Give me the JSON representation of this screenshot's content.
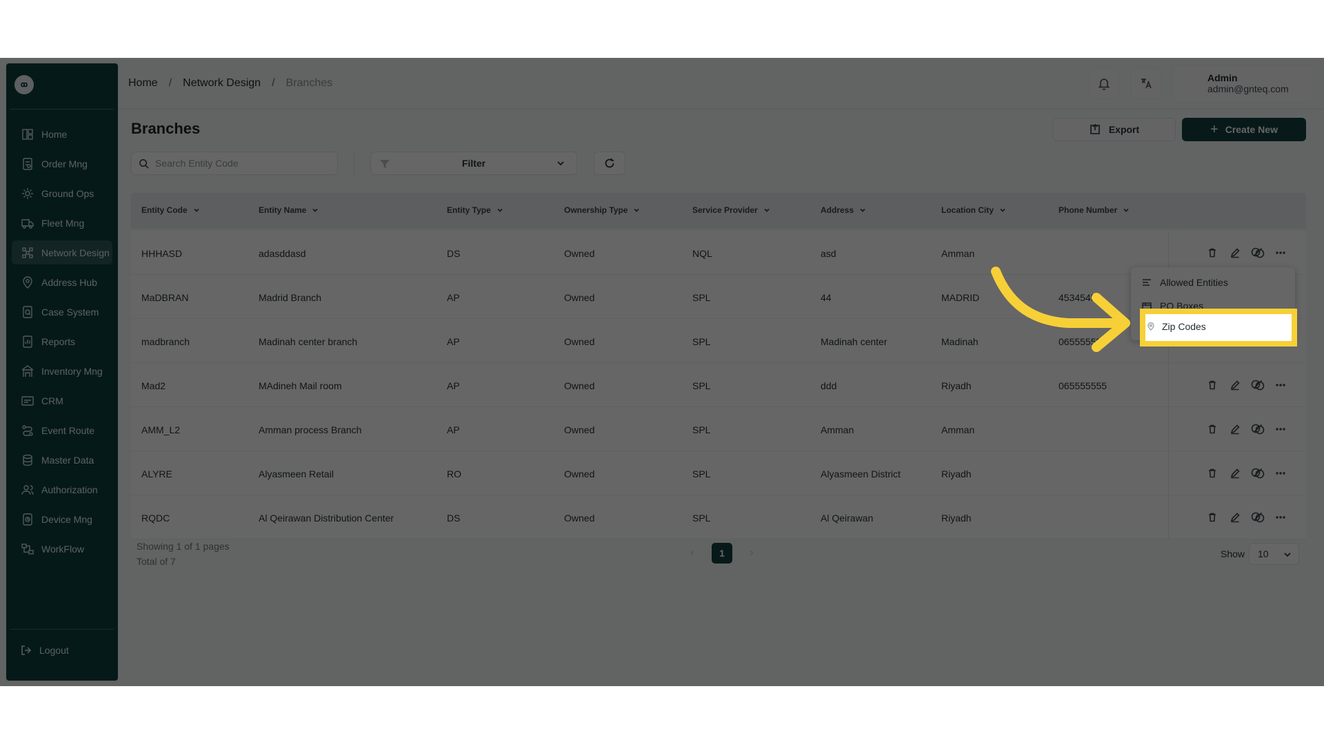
{
  "breadcrumb": {
    "items": [
      "Home",
      "Network Design",
      "Branches"
    ],
    "separator": "/"
  },
  "user": {
    "name": "Admin",
    "email": "admin@gnteq.com"
  },
  "sidebar": {
    "items": [
      {
        "label": "Home",
        "icon": "home-icon"
      },
      {
        "label": "Order Mng",
        "icon": "order-icon"
      },
      {
        "label": "Ground Ops",
        "icon": "ground-ops-icon"
      },
      {
        "label": "Fleet Mng",
        "icon": "truck-icon"
      },
      {
        "label": "Network Design",
        "icon": "network-icon",
        "active": true
      },
      {
        "label": "Address Hub",
        "icon": "location-icon"
      },
      {
        "label": "Case System",
        "icon": "case-icon"
      },
      {
        "label": "Reports",
        "icon": "report-icon"
      },
      {
        "label": "Inventory Mng",
        "icon": "inventory-icon"
      },
      {
        "label": "CRM",
        "icon": "crm-icon"
      },
      {
        "label": "Event Route",
        "icon": "route-icon"
      },
      {
        "label": "Master Data",
        "icon": "database-icon"
      },
      {
        "label": "Authorization",
        "icon": "users-icon"
      },
      {
        "label": "Device Mng",
        "icon": "device-icon"
      },
      {
        "label": "WorkFlow",
        "icon": "workflow-icon"
      }
    ],
    "logout_label": "Logout"
  },
  "page": {
    "title": "Branches",
    "export_label": "Export",
    "create_label": "Create New",
    "search_placeholder": "Search Entity Code",
    "filter_label": "Filter"
  },
  "table": {
    "columns": [
      "Entity Code",
      "Entity Name",
      "Entity Type",
      "Ownership Type",
      "Service Provider",
      "Address",
      "Location City",
      "Phone Number"
    ],
    "rows": [
      [
        "HHHASD",
        "adasddasd",
        "DS",
        "Owned",
        "NQL",
        "asd",
        "Amman",
        ""
      ],
      [
        "MaDBRAN",
        "Madrid Branch",
        "AP",
        "Owned",
        "SPL",
        "44",
        "MADRID",
        "45345454"
      ],
      [
        "madbranch",
        "Madinah center branch",
        "AP",
        "Owned",
        "SPL",
        "Madinah center",
        "Madinah",
        "06555555"
      ],
      [
        "Mad2",
        "MAdineh Mail room",
        "AP",
        "Owned",
        "SPL",
        "ddd",
        "Riyadh",
        "065555555"
      ],
      [
        "AMM_L2",
        "Amman process Branch",
        "AP",
        "Owned",
        "SPL",
        "Amman",
        "Amman",
        ""
      ],
      [
        "ALYRE",
        "Alyasmeen Retail",
        "RO",
        "Owned",
        "SPL",
        "Alyasmeen District",
        "Riyadh",
        ""
      ],
      [
        "RQDC",
        "Al Qeirawan Distribution Center",
        "DS",
        "Owned",
        "SPL",
        "Al Qeirawan",
        "Riyadh",
        ""
      ]
    ]
  },
  "context_menu": {
    "items": [
      "Allowed Entities",
      "PO Boxes",
      "Zip Codes"
    ],
    "highlighted": "Zip Codes",
    "highlight_color": "#f7d038"
  },
  "pagination": {
    "showing": "Showing 1 of 1 pages",
    "total": "Total of 7",
    "current_page": "1",
    "show_label": "Show",
    "page_size": "10"
  },
  "colors": {
    "brand": "#123f3f",
    "sidebar": "#0f4040",
    "annotation": "#f7d038"
  }
}
